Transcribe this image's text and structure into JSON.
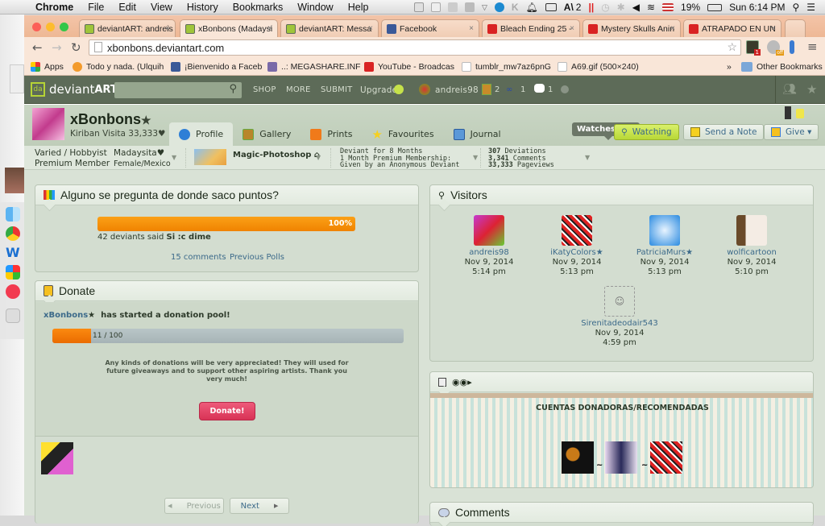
{
  "menubar": {
    "app": "Chrome",
    "items": [
      "File",
      "Edit",
      "View",
      "History",
      "Bookmarks",
      "Window",
      "Help"
    ],
    "adobe_count": "2",
    "battery": "19%",
    "clock": "Sun 6:14 PM"
  },
  "browser": {
    "tabs": [
      {
        "title": "deviantART: andreis",
        "favicon": "deviantart-icon"
      },
      {
        "title": "xBonbons (Madaysi",
        "favicon": "deviantart-icon",
        "active": true
      },
      {
        "title": "deviantART: Messa",
        "favicon": "deviantart-icon"
      },
      {
        "title": "Facebook",
        "favicon": "facebook-icon"
      },
      {
        "title": "Bleach Ending 25 -",
        "favicon": "youtube-icon"
      },
      {
        "title": "Mystery Skulls Anin",
        "favicon": "youtube-icon"
      },
      {
        "title": "ATRAPADO EN UN",
        "favicon": "youtube-icon"
      }
    ],
    "url": "xbonbons.deviantart.com",
    "ext_badge": "1",
    "ext_off": "off",
    "bookmarks": [
      {
        "label": "Apps"
      },
      {
        "label": "Todo y nada. (Ulquih"
      },
      {
        "label": "¡Bienvenido a Faceb"
      },
      {
        "label": "..: MEGASHARE.INF"
      },
      {
        "label": "YouTube - Broadcas"
      },
      {
        "label": "tumblr_mw7az6pnG"
      },
      {
        "label": "A69.gif (500×240)"
      }
    ],
    "more_bookmarks": "»",
    "other_bookmarks": "Other Bookmarks"
  },
  "da_header": {
    "logo_thin": "deviant",
    "logo_bold": "ART",
    "nav": [
      "SHOP",
      "MORE",
      "SUBMIT",
      "Upgrade"
    ],
    "username": "andreis98",
    "notif_deviations": "2",
    "notif_watch": "1",
    "notif_messages": "1"
  },
  "profile": {
    "name": "xBonbons",
    "subtitle": "Kiriban Visita 33,333♥",
    "tabs": [
      "Profile",
      "Gallery",
      "Prints",
      "Favourites",
      "Journal"
    ],
    "tooltip": "Watches You",
    "watching_label": "Watching",
    "note_label": "Send a Note",
    "give_label": "Give ▾",
    "info": {
      "type_line1": "Varied / Hobbyist",
      "type_line2": "Premium Member",
      "realname": "Madaysita♥",
      "location": "Female/Mexico",
      "group": "Magic-Photoshop",
      "deviant_for": "Deviant for 8 Months",
      "membership": "1 Month Premium Membership:",
      "given_by": "Given by an Anonymous Deviant",
      "stats": [
        {
          "num": "307",
          "label": "Deviations"
        },
        {
          "num": "3,341",
          "label": "Comments"
        },
        {
          "num": "33,333",
          "label": "Pageviews"
        }
      ]
    }
  },
  "poll": {
    "title": "Alguno se pregunta de donde saco puntos?",
    "percent_label": "100%",
    "percent": 100,
    "result_prefix": "42 deviants said ",
    "result_answer": "Si :c dime",
    "comments_link": "15 comments",
    "previous_link": "Previous Polls"
  },
  "donate": {
    "title": "Donate",
    "user": "xBonbons",
    "started": "has started a donation pool!",
    "progress_label": "11 / 100",
    "progress_fraction": 0.11,
    "message": "Any kinds of donations will be very appreciated! They will used for future giveaways and to support other aspiring artists. Thank you very much!",
    "button": "Donate!"
  },
  "pager": {
    "prev": "Previous",
    "next": "Next"
  },
  "visitors": {
    "title": "Visitors",
    "list": [
      {
        "name": "andreis98",
        "date": "Nov 9, 2014",
        "time": "5:14 pm"
      },
      {
        "name": "iKatyColors★",
        "date": "Nov 9, 2014",
        "time": "5:13 pm"
      },
      {
        "name": "PatriciaMurs★",
        "date": "Nov 9, 2014",
        "time": "5:13 pm"
      },
      {
        "name": "wolficartoon",
        "date": "Nov 9, 2014",
        "time": "5:10 pm"
      },
      {
        "name": "Sirenitadeodair543",
        "date": "Nov 9, 2014",
        "time": "4:59 pm"
      }
    ]
  },
  "custom_box": {
    "heading": "CUENTAS DONADORAS/RECOMENDADAS",
    "separator": "~"
  },
  "comments": {
    "title": "Comments"
  },
  "colors": {
    "da_header": "#5d6b58",
    "page_bg": "#d9e2d6",
    "accent_link": "#3c6a8a",
    "poll_orange": "#f28a00",
    "donate_red": "#e03c5c",
    "watch_green": "#c5e04a"
  }
}
